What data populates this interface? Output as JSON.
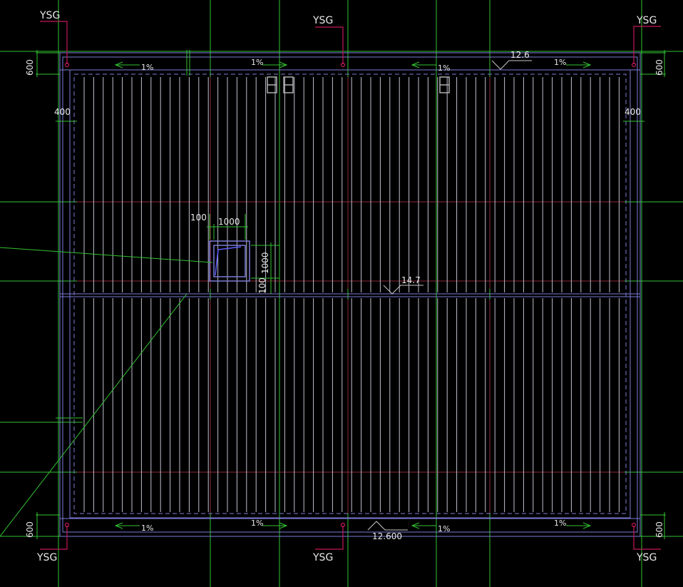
{
  "drawing": {
    "colors": {
      "background": "#000000",
      "grid": "#33c233",
      "axis": "#8a2a3a",
      "outline": "#7b7bd8",
      "joist": "#c8c8d8",
      "pipe_marker": "#c2185b",
      "text": "#e8e8e8"
    },
    "pipe_labels": [
      {
        "id": "ysg-top-left",
        "text": "YSG"
      },
      {
        "id": "ysg-top-middle",
        "text": "YSG"
      },
      {
        "id": "ysg-top-right",
        "text": "YSG"
      },
      {
        "id": "ysg-bottom-left",
        "text": "YSG"
      },
      {
        "id": "ysg-bottom-middle",
        "text": "YSG"
      },
      {
        "id": "ysg-bottom-right",
        "text": "YSG"
      }
    ],
    "dimensions": {
      "left_top_600": "600",
      "right_top_600": "600",
      "left_bottom_600": "600",
      "right_bottom_600": "600",
      "left_400": "400",
      "right_400": "400",
      "opening_offset_100": "100",
      "opening_width_1000": "1000",
      "opening_height_1000": "1000",
      "opening_bottom_100": "100"
    },
    "slopes": [
      {
        "id": "slope-top-1",
        "text": "1%"
      },
      {
        "id": "slope-top-2",
        "text": "1%"
      },
      {
        "id": "slope-top-3",
        "text": "1%"
      },
      {
        "id": "slope-top-4",
        "text": "1%"
      },
      {
        "id": "slope-bottom-1",
        "text": "1%"
      },
      {
        "id": "slope-bottom-2",
        "text": "1%"
      },
      {
        "id": "slope-bottom-3",
        "text": "1%"
      },
      {
        "id": "slope-bottom-4",
        "text": "1%"
      }
    ],
    "elevations": {
      "top_eave": "12.6",
      "ridge": "14.7",
      "bottom_eave": "12.600"
    }
  }
}
